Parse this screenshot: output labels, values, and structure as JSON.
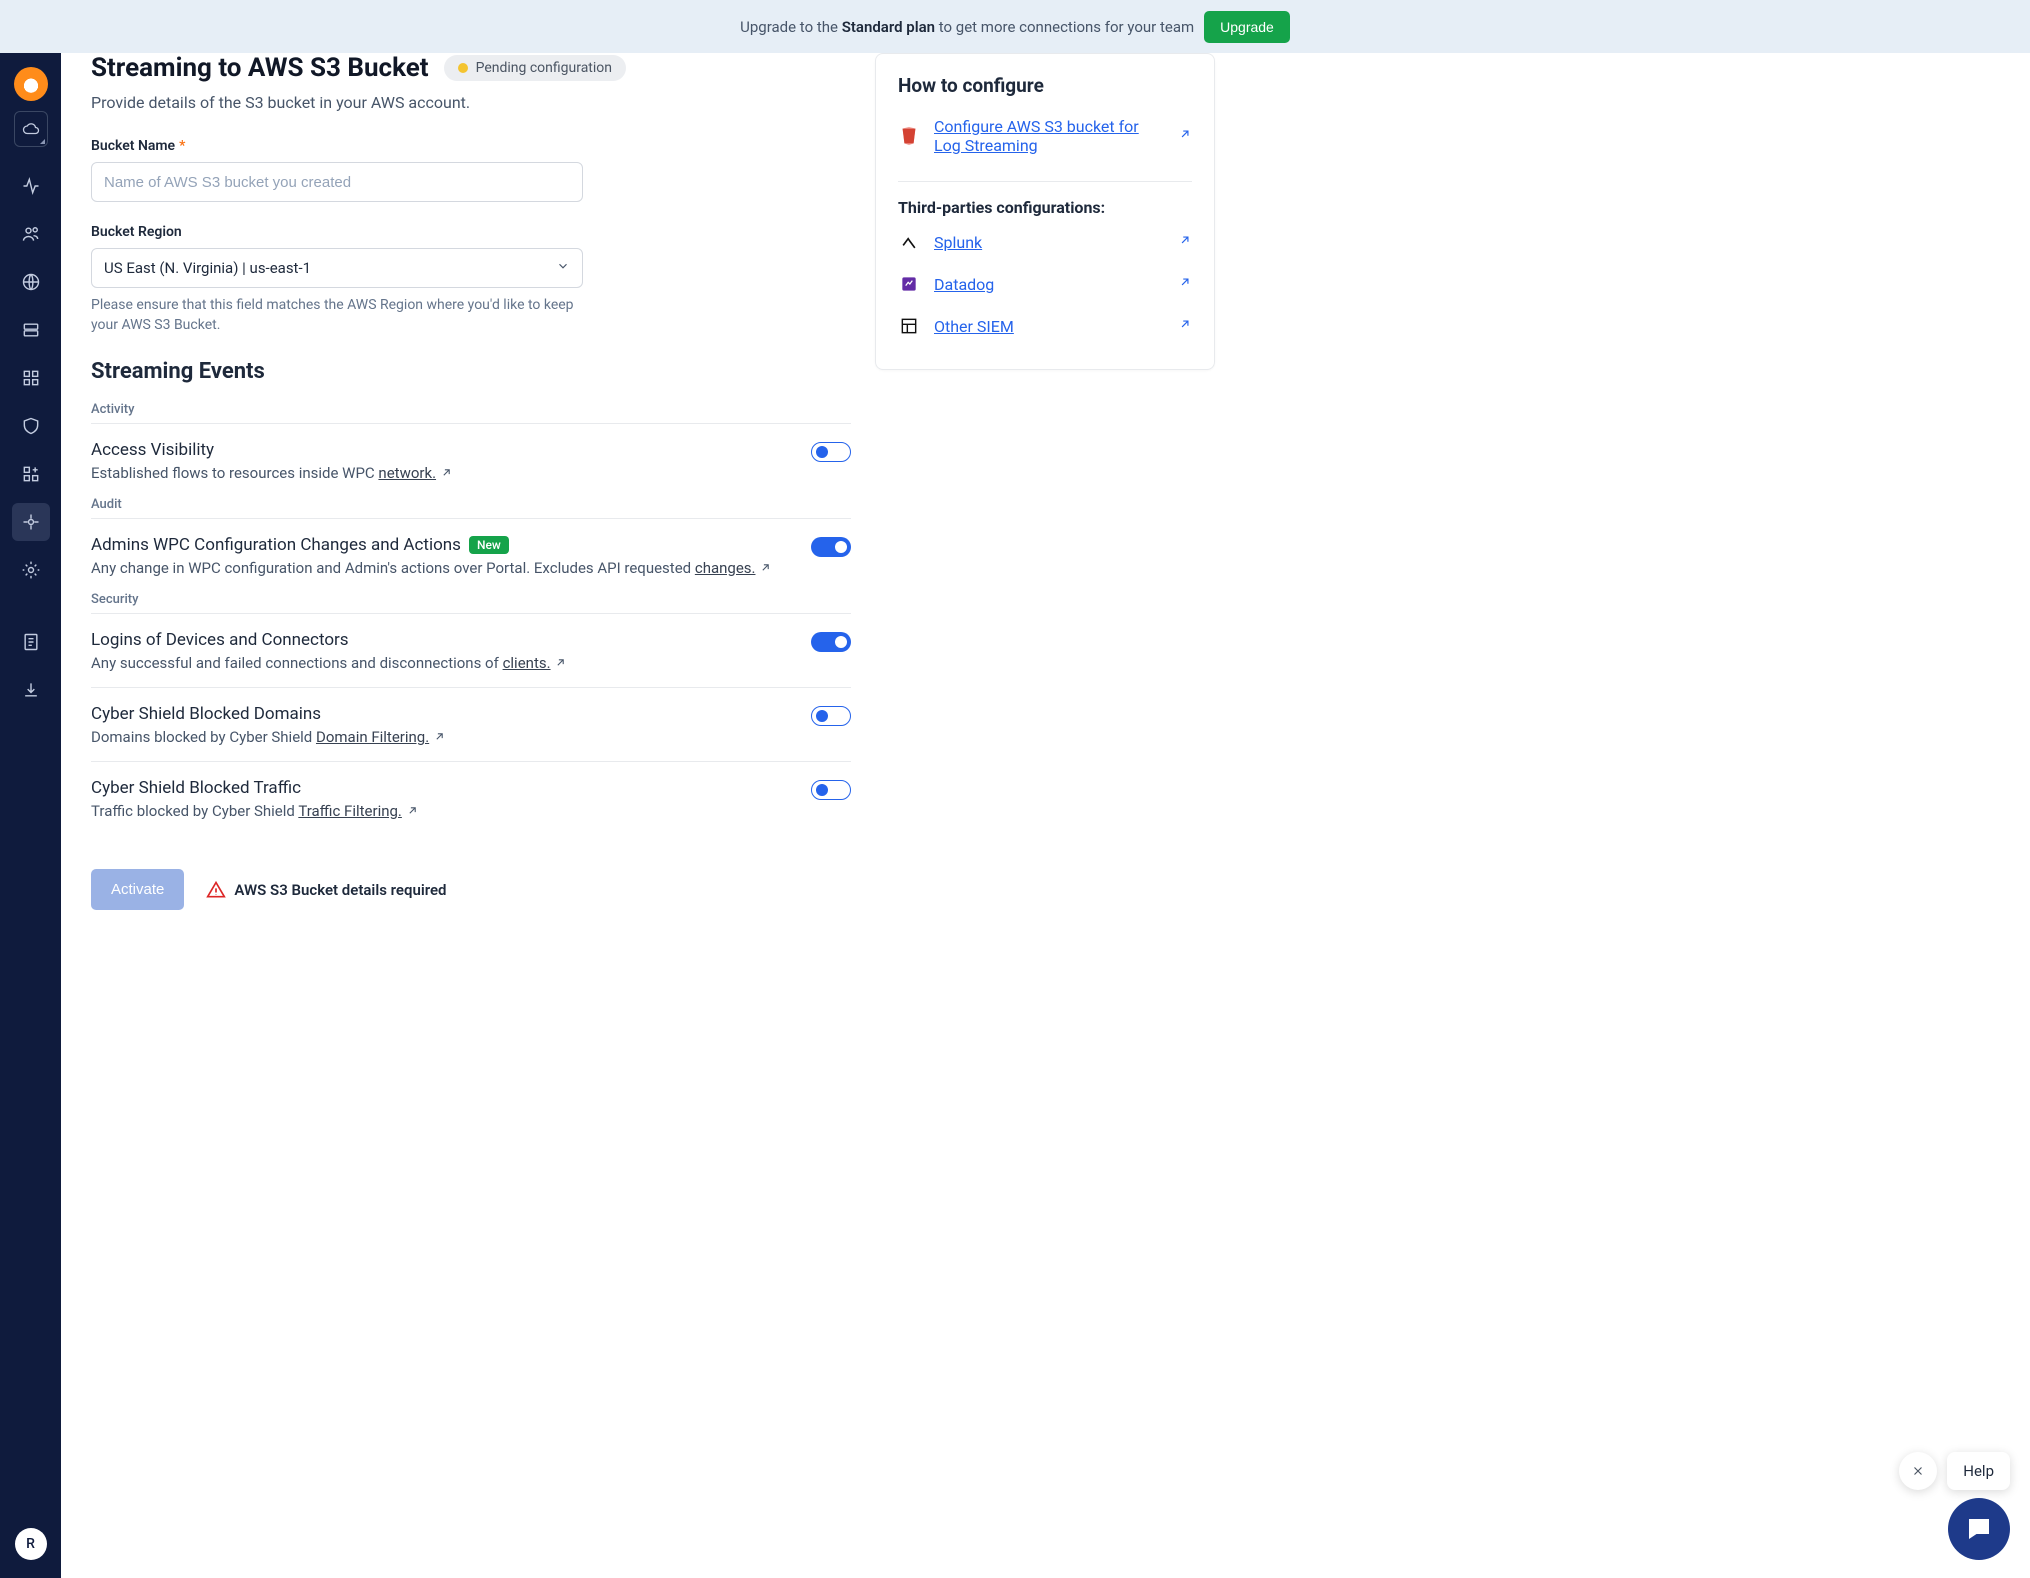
{
  "banner": {
    "pre": "Upgrade to the ",
    "plan": "Standard plan",
    "post": " to get more connections for your team",
    "button": "Upgrade"
  },
  "sidebar": {
    "avatar": "R"
  },
  "page": {
    "title": "Streaming to AWS S3 Bucket",
    "status": "Pending configuration",
    "subtitle": "Provide details of the S3 bucket in your AWS account."
  },
  "form": {
    "bucket_name_label": "Bucket Name",
    "bucket_name_placeholder": "Name of AWS S3 bucket you created",
    "bucket_region_label": "Bucket Region",
    "bucket_region_value": "US East (N. Virginia) | us-east-1",
    "bucket_region_help": "Please ensure that this field matches the AWS Region where you'd like to keep your AWS S3 Bucket."
  },
  "events_heading": "Streaming Events",
  "groups": [
    {
      "label": "Activity",
      "rows": [
        {
          "title": "Access Visibility",
          "desc": "Established flows to resources inside WPC ",
          "link": "network.",
          "on": false,
          "new": false
        }
      ]
    },
    {
      "label": "Audit",
      "rows": [
        {
          "title": "Admins WPC Configuration Changes and Actions",
          "desc": "Any change in WPC configuration and Admin's actions over Portal. Excludes API requested ",
          "link": "changes.",
          "on": true,
          "new": true
        }
      ]
    },
    {
      "label": "Security",
      "rows": [
        {
          "title": "Logins of Devices and Connectors",
          "desc": "Any successful and failed connections and disconnections of ",
          "link": "clients.",
          "on": true,
          "new": false
        },
        {
          "title": "Cyber Shield Blocked Domains",
          "desc": "Domains blocked by Cyber Shield ",
          "link": "Domain Filtering.",
          "on": false,
          "new": false
        },
        {
          "title": "Cyber Shield Blocked Traffic",
          "desc": "Traffic blocked by Cyber Shield ",
          "link": "Traffic Filtering.",
          "on": false,
          "new": false
        }
      ]
    }
  ],
  "footer": {
    "activate": "Activate",
    "warning": "AWS S3 Bucket details required"
  },
  "howto": {
    "heading": "How to configure",
    "primary": "Configure AWS S3 bucket for Log Streaming",
    "third_party_heading": "Third-parties configurations:",
    "links": [
      "Splunk",
      "Datadog",
      "Other SIEM"
    ]
  },
  "help": {
    "label": "Help"
  },
  "new_label": "New"
}
